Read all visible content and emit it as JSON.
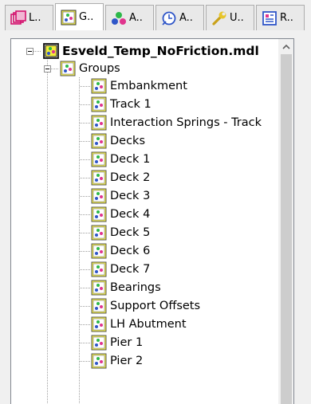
{
  "tabs": [
    {
      "label": "L..",
      "icon": "layers-icon",
      "active": false
    },
    {
      "label": "G..",
      "icon": "group-icon",
      "active": true
    },
    {
      "label": "A..",
      "icon": "attributes-icon",
      "active": false
    },
    {
      "label": "A..",
      "icon": "analysis-icon",
      "active": false
    },
    {
      "label": "U..",
      "icon": "utilities-icon",
      "active": false
    },
    {
      "label": "R..",
      "icon": "report-icon",
      "active": false
    }
  ],
  "tree": {
    "root_label": "Esveld_Temp_NoFriction.mdl",
    "groups_label": "Groups",
    "items": [
      "Embankment",
      "Track 1",
      "Interaction Springs - Track",
      "Decks",
      "Deck 1",
      "Deck 2",
      "Deck 3",
      "Deck 4",
      "Deck 5",
      "Deck 6",
      "Deck 7",
      "Bearings",
      "Support Offsets",
      "LH Abutment",
      "Pier 1",
      "Pier 2"
    ]
  },
  "colors": {
    "panel_border": "#828790",
    "scroll_thumb": "#cdcdcd",
    "group_icon_yellow": "#f5ef3a",
    "group_icon_green": "#2db84a",
    "group_icon_pink": "#e0348d",
    "group_icon_blue": "#2f56c8"
  }
}
